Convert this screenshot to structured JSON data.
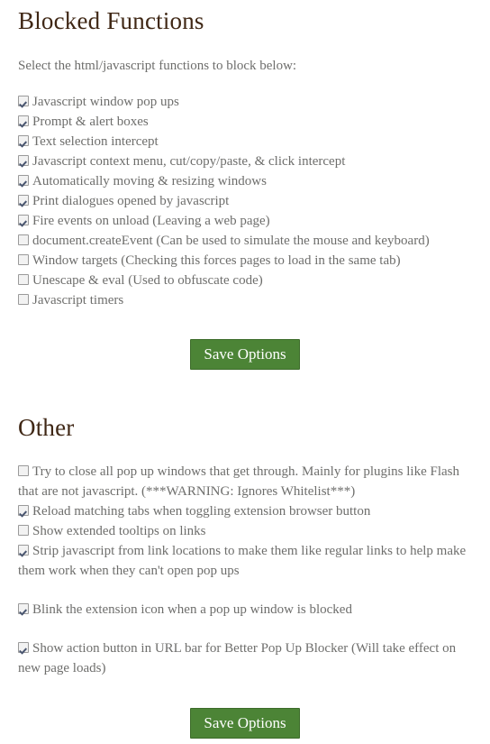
{
  "blocked_section": {
    "title": "Blocked Functions",
    "intro": "Select the html/javascript functions to block below:",
    "items": [
      {
        "label": "Javascript window pop ups",
        "checked": true
      },
      {
        "label": "Prompt & alert boxes",
        "checked": true
      },
      {
        "label": "Text selection intercept",
        "checked": true
      },
      {
        "label": "Javascript context menu, cut/copy/paste, & click intercept",
        "checked": true
      },
      {
        "label": "Automatically moving & resizing windows",
        "checked": true
      },
      {
        "label": "Print dialogues opened by javascript",
        "checked": true
      },
      {
        "label": "Fire events on unload (Leaving a web page)",
        "checked": true
      },
      {
        "label": "document.createEvent (Can be used to simulate the mouse and keyboard)",
        "checked": false
      },
      {
        "label": "Window targets (Checking this forces pages to load in the same tab)",
        "checked": false
      },
      {
        "label": "Unescape & eval (Used to obfuscate code)",
        "checked": false
      },
      {
        "label": "Javascript timers",
        "checked": false
      }
    ],
    "save_label": "Save Options"
  },
  "other_section": {
    "title": "Other",
    "items": [
      {
        "label": "Try to close all pop up windows that get through. Mainly for plugins like Flash that are not javascript. (***WARNING: Ignores Whitelist***)",
        "checked": false,
        "spaced": false
      },
      {
        "label": "Reload matching tabs when toggling extension browser button",
        "checked": true,
        "spaced": false
      },
      {
        "label": "Show extended tooltips on links",
        "checked": false,
        "spaced": false
      },
      {
        "label": "Strip javascript from link locations to make them like regular links to help make them work when they can't open pop ups",
        "checked": true,
        "spaced": false
      },
      {
        "label": "Blink the extension icon when a pop up window is blocked",
        "checked": true,
        "spaced": true
      },
      {
        "label": "Show action button in URL bar for Better Pop Up Blocker (Will take effect on new page loads)",
        "checked": true,
        "spaced": true
      }
    ],
    "save_label": "Save Options"
  },
  "colors": {
    "heading": "#3f2715",
    "body_text": "#6e6e6c",
    "button_green": "#4c8436",
    "button_border": "#3c6b2a",
    "checkbox_border": "#9a9a9a",
    "checkbox_fill": "#f2f2f2",
    "check_mark": "#4a5670",
    "background": "#ffffff"
  }
}
